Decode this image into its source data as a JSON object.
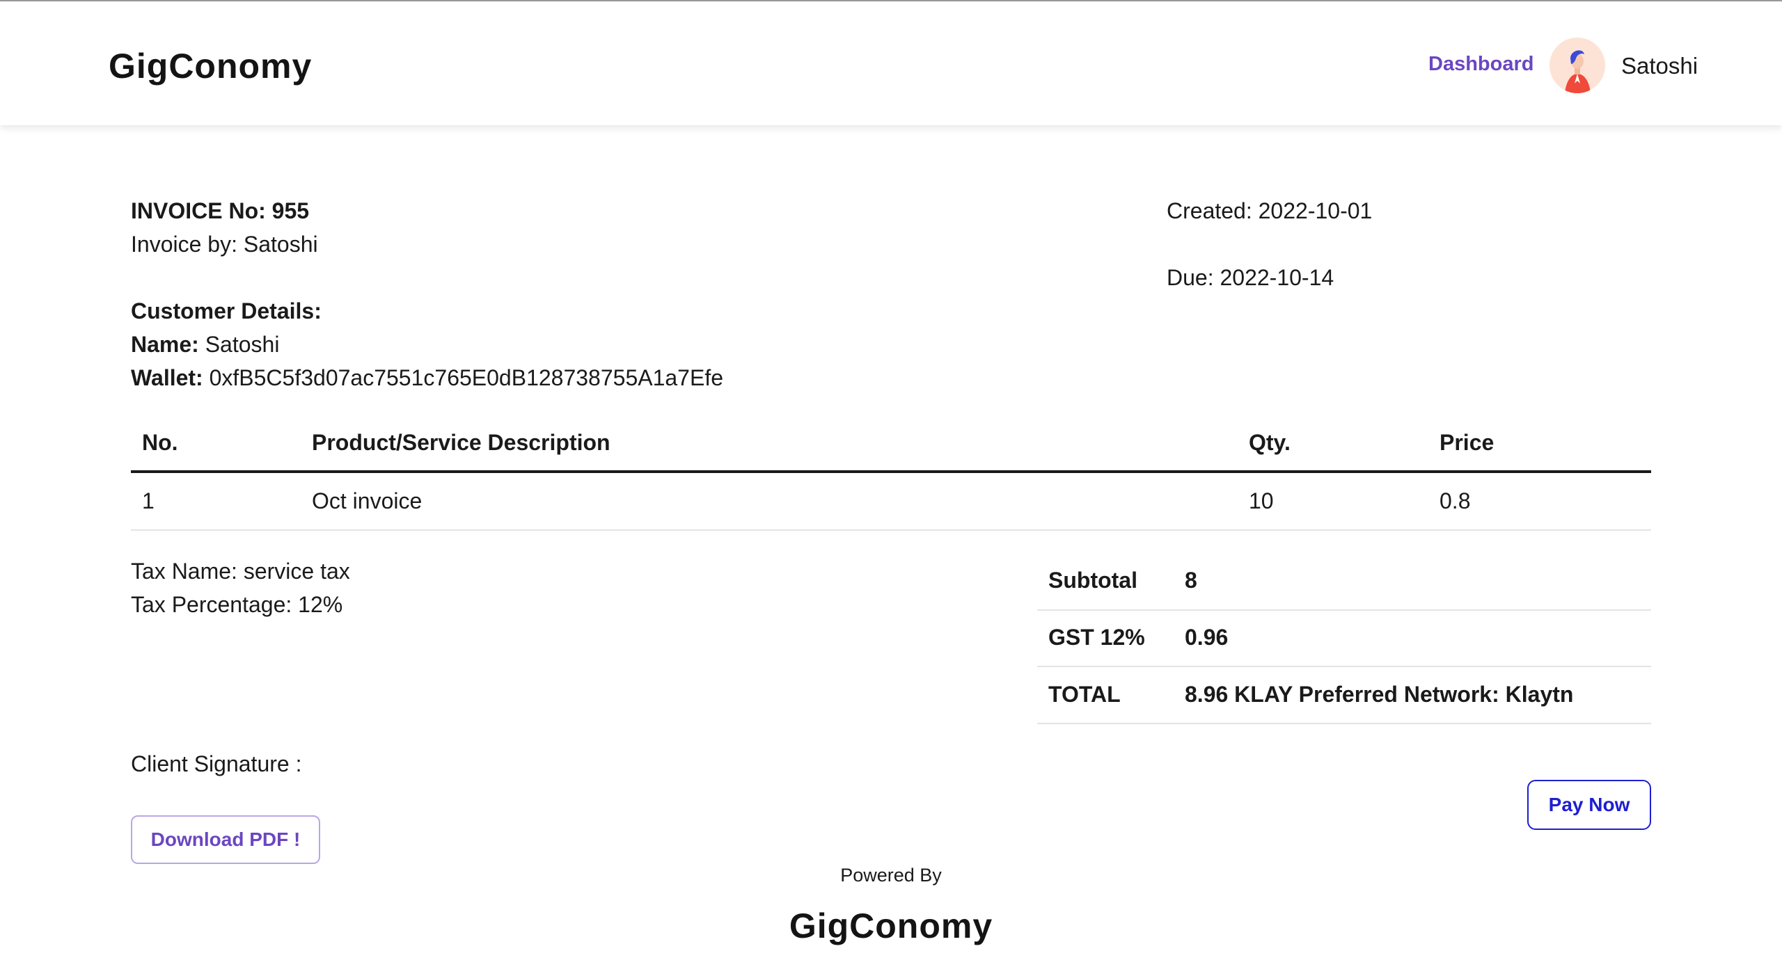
{
  "header": {
    "logo": "GigConomy",
    "nav_dashboard": "Dashboard",
    "username": "Satoshi",
    "avatar_icon": "person-avatar-icon"
  },
  "invoice": {
    "number_label": "INVOICE No: 955",
    "invoice_by": "Invoice by: Satoshi",
    "created": "Created: 2022-10-01",
    "due": "Due: 2022-10-14",
    "customer_heading": "Customer Details:",
    "name_label": "Name:",
    "name_value": "Satoshi",
    "wallet_label": "Wallet:",
    "wallet_value": "0xfB5C5f3d07ac7551c765E0dB128738755A1a7Efe"
  },
  "table": {
    "headers": [
      "No.",
      "Product/Service Description",
      "Qty.",
      "Price"
    ],
    "rows": [
      [
        "1",
        "Oct invoice",
        "10",
        "0.8"
      ]
    ]
  },
  "tax": {
    "name": "Tax Name: service tax",
    "percentage": "Tax Percentage: 12%"
  },
  "totals": {
    "subtotal_label": "Subtotal",
    "subtotal_value": "8",
    "gst_label": "GST 12%",
    "gst_value": "0.96",
    "total_label": "TOTAL",
    "total_value": "8.96 KLAY Preferred Network: Klaytn"
  },
  "signature_label": "Client Signature :",
  "buttons": {
    "download_pdf": "Download PDF !",
    "pay_now": "Pay Now"
  },
  "footer": {
    "powered_by": "Powered By",
    "logo": "GigConomy"
  },
  "colors": {
    "accent_purple": "#6b46c1",
    "pay_blue": "#1e1ed2",
    "avatar_bg": "#fde3d6"
  }
}
